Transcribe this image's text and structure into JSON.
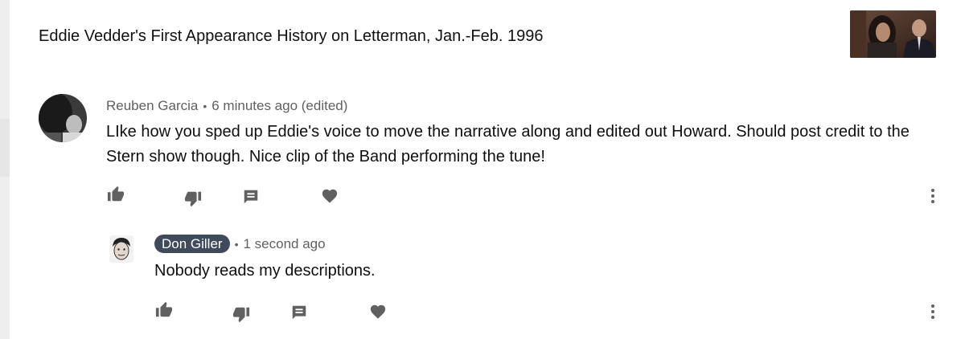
{
  "video": {
    "title": "Eddie Vedder's First Appearance History on Letterman, Jan.-Feb. 1996"
  },
  "comment": {
    "author": "Reuben Garcia",
    "separator": "•",
    "time": "6 minutes ago (edited)",
    "text": "LIke how you sped up Eddie's voice to move the narrative along and edited out Howard. Should post credit to the Stern show though. Nice clip of the Band performing the tune!"
  },
  "reply": {
    "author": "Don Giller",
    "separator": "•",
    "time": "1 second ago",
    "text": "Nobody reads my descriptions."
  },
  "icons": {
    "like": "thumb-up-icon",
    "dislike": "thumb-down-icon",
    "reply": "reply-comment-icon",
    "heart": "heart-icon",
    "more": "more-vertical-icon"
  },
  "colors": {
    "icon_gray": "#606060",
    "author_badge": "#3f4b5a",
    "text": "#0f0f0f",
    "meta": "#606060"
  }
}
